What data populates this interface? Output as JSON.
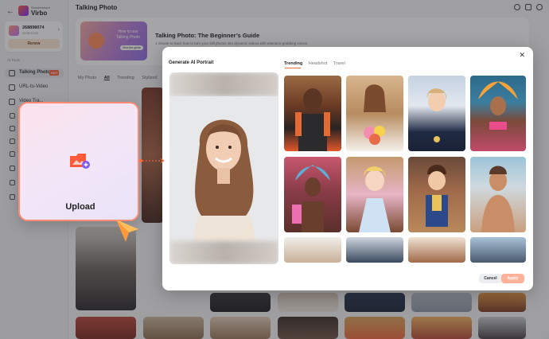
{
  "sidebar": {
    "logo_small": "Wondershare",
    "logo_name": "Virbo",
    "account_id": "268898074",
    "account_date": "2025/12/20",
    "renew_label": "Renew",
    "section_label": "AI Tools",
    "items": [
      {
        "label": "Talking Photo",
        "badge": "HOT"
      },
      {
        "label": "URL-to-Video"
      },
      {
        "label": "Video Tra..."
      }
    ]
  },
  "header": {
    "title": "Talking Photo"
  },
  "banner": {
    "thumb_text": "How to use Talking Photo",
    "thumb_button": "View the guide",
    "heading": "Talking Photo: The Beginner’s Guide",
    "subtext": "1 minute to learn how to turn your still photos into dynamic videos with attention-grabbing voices."
  },
  "filter_tabs": [
    "My Photo",
    "All",
    "Trending",
    "Stylized"
  ],
  "modal": {
    "title": "Generate AI Portrait",
    "tabs": [
      "Trending",
      "Headshot",
      "Travel"
    ],
    "active_tab": "Trending",
    "cancel_label": "Cancel",
    "apply_label": "Apply"
  },
  "upload": {
    "label": "Upload"
  },
  "colors": {
    "accent": "#ff6a3d",
    "apply_disabled": "#ffb199",
    "upload_border": "#ff8a72"
  },
  "icons": [
    "back-icon",
    "logo-icon",
    "chevron-right-icon",
    "headset-icon",
    "mail-icon",
    "help-icon",
    "close-icon",
    "image-plus-icon",
    "cursor-icon"
  ]
}
